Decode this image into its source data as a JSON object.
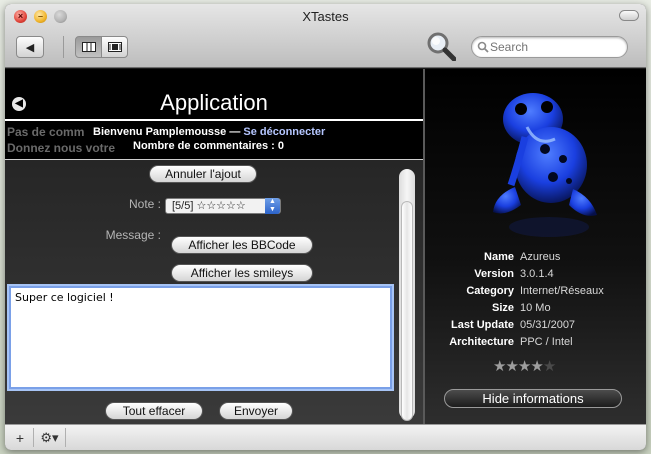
{
  "window": {
    "title": "XTastes"
  },
  "toolbar": {
    "search_placeholder": "Search",
    "back_glyph": "◀"
  },
  "app": {
    "title": "Application",
    "ghost_line1": "Pas de comm",
    "ghost_line2": "Donnez nous votre",
    "welcome": "Bienvenu Pamplemousse — ",
    "logout": "Se déconnecter",
    "comments_count": "Nombre de commentaires : 0"
  },
  "form": {
    "cancel_label": "Annuler l'ajout",
    "note_label": "Note :",
    "rating_value": "[5/5] ☆☆☆☆☆",
    "message_label": "Message :",
    "bbcode_label": "Afficher les BBCode",
    "smileys_label": "Afficher les smileys",
    "message_text": "Super ce logiciel !",
    "clear_label": "Tout effacer",
    "send_label": "Envoyer"
  },
  "info": {
    "rows": [
      {
        "key": "Name",
        "value": "Azureus"
      },
      {
        "key": "Version",
        "value": "3.0.1.4"
      },
      {
        "key": "Category",
        "value": "Internet/Réseaux"
      },
      {
        "key": "Size",
        "value": "10 Mo"
      },
      {
        "key": "Last Update",
        "value": "05/31/2007"
      },
      {
        "key": "Architecture",
        "value": "PPC / Intel"
      }
    ],
    "rating": 4,
    "rating_max": 5,
    "hide_label": "Hide informations"
  },
  "bottombar": {
    "add_glyph": "+",
    "gear_glyph": "⚙▾"
  },
  "colors": {
    "frog_blue": "#1a3fe0",
    "selection_blue": "#7aa0e8"
  }
}
